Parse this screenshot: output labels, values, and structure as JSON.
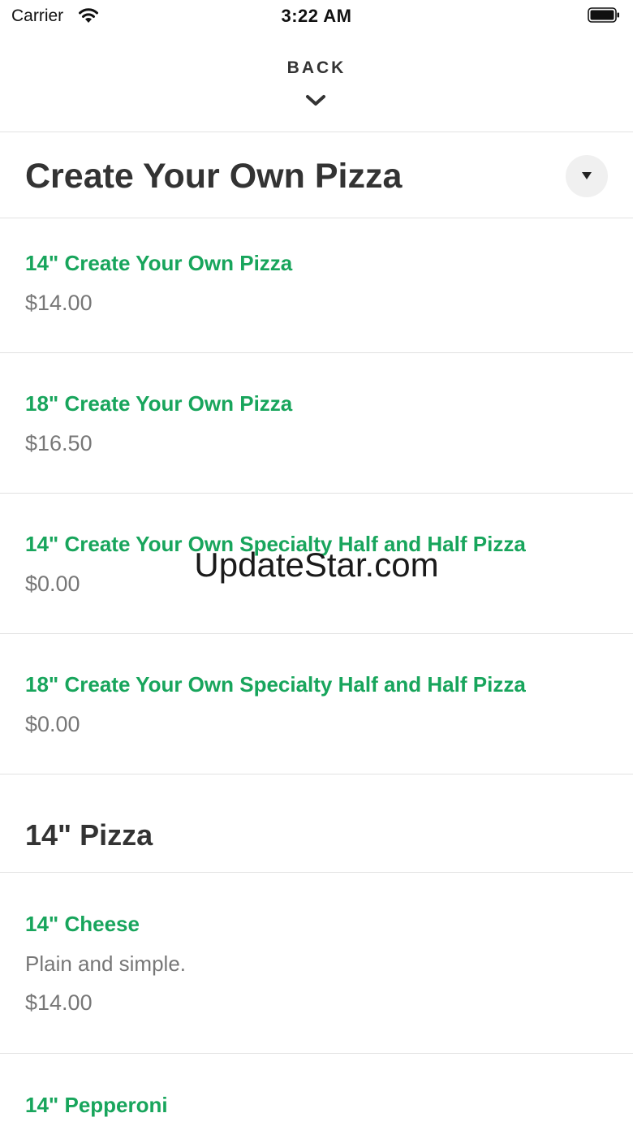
{
  "status_bar": {
    "carrier": "Carrier",
    "time": "3:22 AM",
    "wifi_icon": "wifi-icon",
    "battery_icon": "battery-icon"
  },
  "nav": {
    "back_label": "BACK",
    "back_icon": "chevron-down-icon"
  },
  "sections": [
    {
      "title": "Create Your Own Pizza",
      "toggle_icon": "caret-down-icon",
      "items": [
        {
          "name": "14\" Create Your Own Pizza",
          "price": "$14.00"
        },
        {
          "name": "18\" Create Your Own Pizza",
          "price": "$16.50"
        },
        {
          "name": "14\" Create Your Own Specialty Half and Half Pizza",
          "price": "$0.00"
        },
        {
          "name": "18\" Create Your Own Specialty Half and Half Pizza",
          "price": "$0.00"
        }
      ]
    },
    {
      "title": "14\" Pizza",
      "items": [
        {
          "name": "14\" Cheese",
          "description": "Plain and simple.",
          "price": "$14.00"
        },
        {
          "name": "14\" Pepperoni"
        }
      ]
    }
  ],
  "watermark": "UpdateStar.com",
  "colors": {
    "accent": "#18a55c",
    "title": "#333333",
    "muted": "#777777",
    "divider": "#e2e2e2"
  }
}
